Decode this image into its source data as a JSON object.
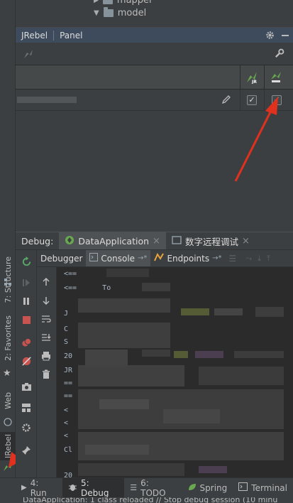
{
  "tree": {
    "items": [
      {
        "label": "mapper"
      },
      {
        "label": "model"
      }
    ]
  },
  "jrebel_panel": {
    "tabs": [
      {
        "label": "JRebel"
      },
      {
        "label": "Panel"
      }
    ],
    "row_checked_jr": "✓",
    "row_checked_remote": "✓"
  },
  "debug": {
    "label": "Debug:",
    "tabs": [
      {
        "label": "DataApplication"
      },
      {
        "label": "数字远程调试"
      }
    ],
    "subtabs": [
      {
        "label": "Debugger"
      },
      {
        "label": "Console"
      },
      {
        "label": "Endpoints"
      }
    ]
  },
  "console_lines": [
    "<==",
    "<==      To",
    "J",
    "C",
    "S",
    "20",
    "JR",
    "==",
    "==",
    "<",
    "<",
    "<",
    "Cl",
    "20"
  ],
  "left_strip": {
    "tabs": [
      {
        "label": "7: Structure"
      },
      {
        "label": "2: Favorites"
      },
      {
        "label": "Web"
      },
      {
        "label": "JRebel"
      }
    ]
  },
  "bottom_tabs": [
    {
      "label": "4: Run"
    },
    {
      "label": "5: Debug"
    },
    {
      "label": "6: TODO"
    },
    {
      "label": "Spring"
    },
    {
      "label": "Terminal"
    }
  ],
  "status": {
    "text": "DataApplication: 1 class reloaded // Stop debug session (10 minu"
  },
  "colors": {
    "accent_red": "#e0301e",
    "jrebel_green": "#6aa84f"
  }
}
